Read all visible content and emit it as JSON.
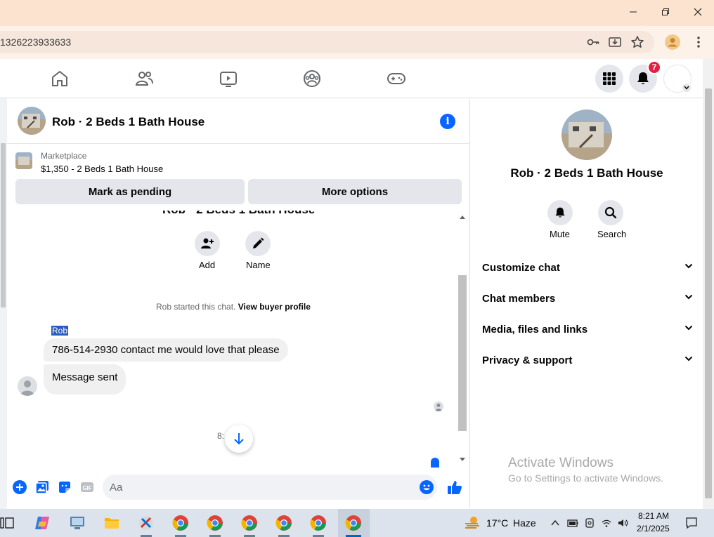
{
  "browser": {
    "url_fragment": "1326223933633"
  },
  "fbnav": {
    "notification_count": "7"
  },
  "chat": {
    "title": "Rob · 2 Beds 1 Bath House",
    "marketplace_label": "Marketplace",
    "listing": "$1,350 - 2 Beds 1 Bath House",
    "mark_pending_label": "Mark as pending",
    "more_options_label": "More options",
    "ghost_title": "Rob · 2 Beds 1 Bath House",
    "add_label": "Add",
    "name_label": "Name",
    "started_text": "Rob started this chat. ",
    "view_buyer_profile": "View buyer profile",
    "sender_name": "Rob",
    "messages": [
      "786-514-2930 contact me would love that please",
      "Message sent"
    ],
    "time_fragment": "8:",
    "composer_placeholder": "Aa"
  },
  "right_panel": {
    "name": "Rob · 2 Beds 1 Bath House",
    "mute_label": "Mute",
    "search_label": "Search",
    "sections": [
      "Customize chat",
      "Chat members",
      "Media, files and links",
      "Privacy & support"
    ],
    "watermark_title": "Activate Windows",
    "watermark_sub": "Go to Settings to activate Windows."
  },
  "taskbar": {
    "temperature": "17°C",
    "condition": "Haze",
    "time": "8:21 AM",
    "date": "2/1/2025"
  },
  "colors": {
    "accent": "#0866ff",
    "badge": "#e41e3f",
    "titlebar": "#fbe3cf"
  }
}
